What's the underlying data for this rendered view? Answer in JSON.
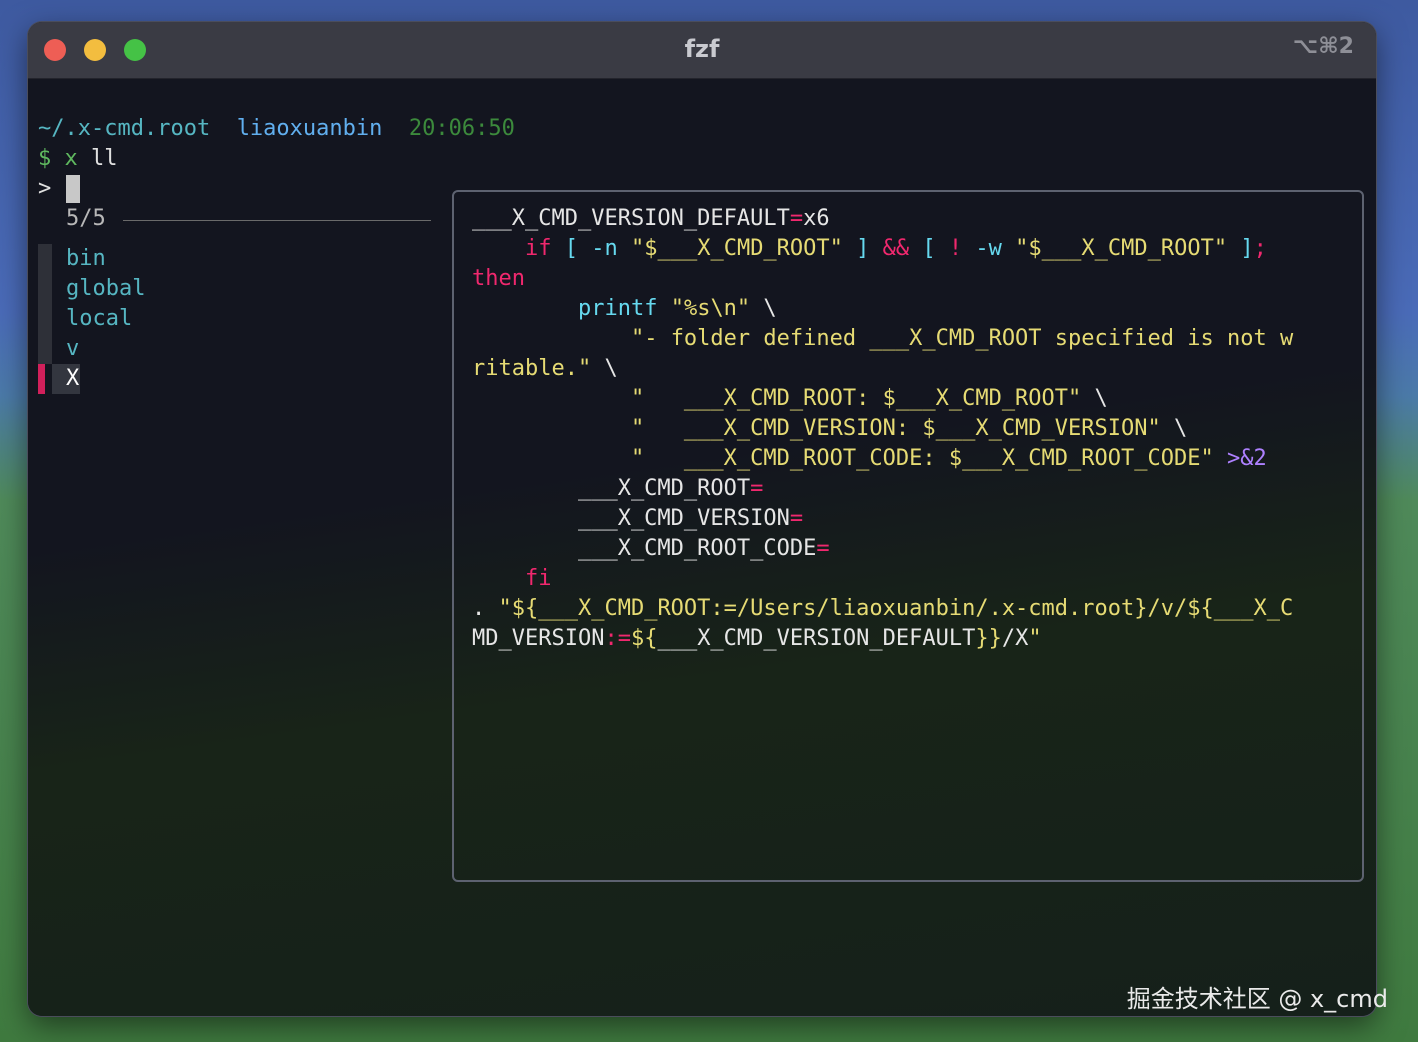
{
  "window": {
    "title": "fzf",
    "shortcut": "⌥⌘2"
  },
  "prompt": {
    "path": "~/.x-cmd.root",
    "user": "liaoxuanbin",
    "time": "20:06:50",
    "dollar": "$",
    "command_x": "x",
    "command_arg": "ll"
  },
  "fzf": {
    "input_marker": ">",
    "count": "5/5",
    "items": [
      {
        "label": "bin",
        "selected": false
      },
      {
        "label": "global",
        "selected": false
      },
      {
        "label": "local",
        "selected": false
      },
      {
        "label": "v",
        "selected": false
      },
      {
        "label": "X",
        "selected": true
      }
    ]
  },
  "preview": {
    "lines": [
      "___X_CMD_VERSION_DEFAULT=x6",
      "    if [ -n \"$___X_CMD_ROOT\" ] && [ ! -w \"$___X_CMD_ROOT\" ];",
      "then",
      "        printf \"%s\\n\" \\",
      "            \"- folder defined ___X_CMD_ROOT specified is not w",
      "ritable.\" \\",
      "            \"   ___X_CMD_ROOT: $___X_CMD_ROOT\" \\",
      "            \"   ___X_CMD_VERSION: $___X_CMD_VERSION\" \\",
      "            \"   ___X_CMD_ROOT_CODE: $___X_CMD_ROOT_CODE\" >&2",
      "        ___X_CMD_ROOT=",
      "        ___X_CMD_VERSION=",
      "        ___X_CMD_ROOT_CODE=",
      "    fi",
      ". \"${___X_CMD_ROOT:=/Users/liaoxuanbin/.x-cmd.root}/v/${___X_C",
      "MD_VERSION:=${___X_CMD_VERSION_DEFAULT}}/X\""
    ]
  },
  "watermark": "掘金技术社区 @ x_cmd"
}
